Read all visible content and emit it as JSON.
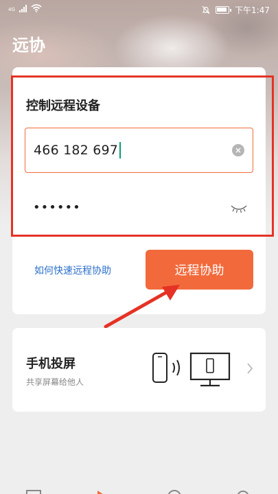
{
  "status_bar": {
    "network": "4G",
    "time": "下午1:47"
  },
  "page": {
    "title": "远协"
  },
  "remote_control": {
    "section_title": "控制远程设备",
    "device_id_value": "466 182 697",
    "password_value": "••••••",
    "help_link": "如何快速远程协助",
    "assist_button": "远程协助"
  },
  "screen_share": {
    "title": "手机投屏",
    "subtitle": "共享屏幕给他人"
  },
  "colors": {
    "accent": "#f26a3c",
    "highlight_box": "#e53225",
    "link": "#2a6fc9"
  },
  "icons": {
    "clear": "clear-icon",
    "eye": "eye-closed-icon",
    "screen_cast": "phone-to-monitor-icon",
    "chevron": "chevron-right-icon"
  }
}
